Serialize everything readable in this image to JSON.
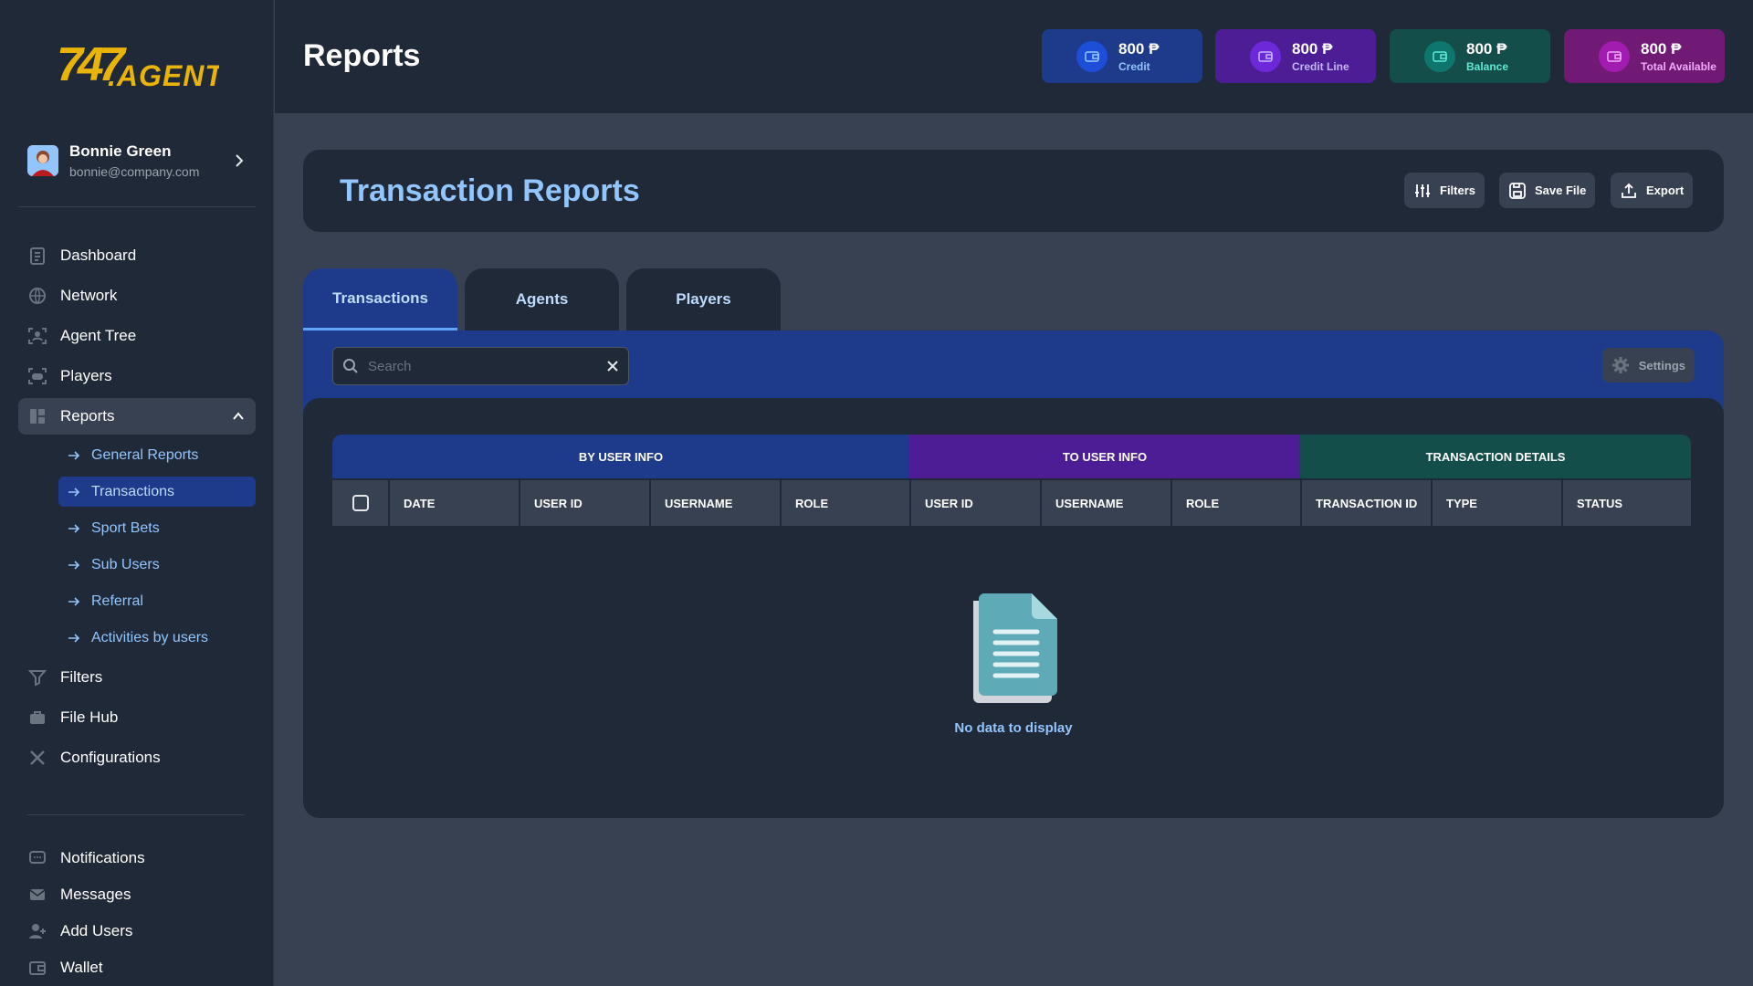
{
  "brand": {
    "logo_text": "747AGENT"
  },
  "user": {
    "name": "Bonnie Green",
    "email": "bonnie@company.com"
  },
  "nav": {
    "main": [
      {
        "label": "Dashboard",
        "icon": "clipboard-icon"
      },
      {
        "label": "Network",
        "icon": "globe-icon"
      },
      {
        "label": "Agent Tree",
        "icon": "user-scan-icon"
      },
      {
        "label": "Players",
        "icon": "gamepad-icon"
      },
      {
        "label": "Reports",
        "icon": "reports-icon"
      }
    ],
    "reports_sub": [
      "General Reports",
      "Transactions",
      "Sport Bets",
      "Sub Users",
      "Referral",
      "Activities by users"
    ],
    "secondary": [
      {
        "label": "Filters",
        "icon": "filter-icon"
      },
      {
        "label": "File Hub",
        "icon": "briefcase-icon"
      },
      {
        "label": "Configurations",
        "icon": "tools-icon"
      }
    ],
    "bottom": [
      {
        "label": "Notifications",
        "icon": "chat-icon"
      },
      {
        "label": "Messages",
        "icon": "envelope-icon"
      },
      {
        "label": "Add Users",
        "icon": "user-plus-icon"
      },
      {
        "label": "Wallet",
        "icon": "wallet-icon"
      }
    ]
  },
  "header": {
    "title": "Reports"
  },
  "stats": [
    {
      "value": "800 ₱",
      "label": "Credit",
      "bg": "#1e3a8a",
      "icon_bg": "#1d4ed8",
      "label_color": "#93c5fd"
    },
    {
      "value": "800 ₱",
      "label": "Credit Line",
      "bg": "#4c1d95",
      "icon_bg": "#6d28d9",
      "label_color": "#c4b5fd"
    },
    {
      "value": "800 ₱",
      "label": "Balance",
      "bg": "#134e4a",
      "icon_bg": "#0f766e",
      "label_color": "#5eead4"
    },
    {
      "value": "800 ₱",
      "label": "Total Available",
      "bg": "#701a75",
      "icon_bg": "#a21caf",
      "label_color": "#f0abfc"
    }
  ],
  "report": {
    "title": "Transaction Reports",
    "buttons": {
      "filters": "Filters",
      "save": "Save File",
      "export": "Export"
    }
  },
  "tabs": [
    "Transactions",
    "Agents",
    "Players"
  ],
  "search": {
    "placeholder": "Search"
  },
  "settings_label": "Settings",
  "table": {
    "groups": [
      {
        "label": "BY USER INFO",
        "color": "#1e3a8a"
      },
      {
        "label": "TO USER INFO",
        "color": "#4c1d95"
      },
      {
        "label": "TRANSACTION DETAILS",
        "color": "#134e4a"
      }
    ],
    "columns": [
      "DATE",
      "USER ID",
      "USERNAME",
      "ROLE",
      "USER ID",
      "USERNAME",
      "ROLE",
      "TRANSACTION ID",
      "TYPE",
      "STATUS"
    ],
    "empty_message": "No data to display"
  }
}
